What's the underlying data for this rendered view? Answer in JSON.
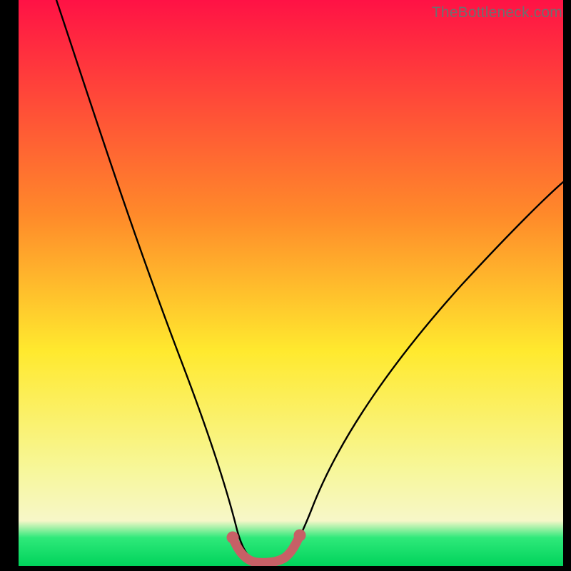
{
  "watermark": {
    "text": "TheBottleneck.com"
  },
  "colors": {
    "black": "#000000",
    "curve": "#000000",
    "marker_fill": "#c76066",
    "marker_stroke": "#c76066",
    "grad_top": "#ff1245",
    "grad_mid1": "#ff8a2a",
    "grad_mid2": "#ffe92e",
    "grad_mid3": "#f7f79a",
    "grad_green": "#2fe97a",
    "grad_bottom": "#00d35b"
  },
  "chart_data": {
    "type": "line",
    "title": "",
    "xlabel": "",
    "ylabel": "",
    "xlim": [
      0,
      100
    ],
    "ylim": [
      0,
      100
    ],
    "grid": false,
    "legend": false,
    "series": [
      {
        "name": "bottleneck-curve",
        "x": [
          7,
          10,
          15,
          20,
          25,
          30,
          35,
          38,
          40,
          42,
          44,
          46,
          48,
          50,
          55,
          60,
          65,
          70,
          75,
          80,
          85,
          90,
          95,
          100
        ],
        "y": [
          100,
          90,
          75,
          61,
          48,
          36,
          24,
          16,
          10,
          4,
          1.5,
          0.5,
          0.5,
          1.5,
          7,
          14,
          21,
          28,
          34,
          40,
          45,
          50,
          55,
          59
        ]
      }
    ],
    "markers": {
      "name": "bottleneck-threshold",
      "x": [
        40,
        42,
        44,
        46,
        48,
        50
      ],
      "y": [
        4,
        1.5,
        0.5,
        0.5,
        1.5,
        4
      ]
    },
    "background_gradient": {
      "direction": "vertical",
      "stops": [
        {
          "pos": 0.0,
          "color": "#ff1245"
        },
        {
          "pos": 0.38,
          "color": "#ff8a2a"
        },
        {
          "pos": 0.62,
          "color": "#ffe92e"
        },
        {
          "pos": 0.83,
          "color": "#f7f79a"
        },
        {
          "pos": 0.95,
          "color": "#2fe97a"
        },
        {
          "pos": 1.0,
          "color": "#00d35b"
        }
      ]
    }
  }
}
